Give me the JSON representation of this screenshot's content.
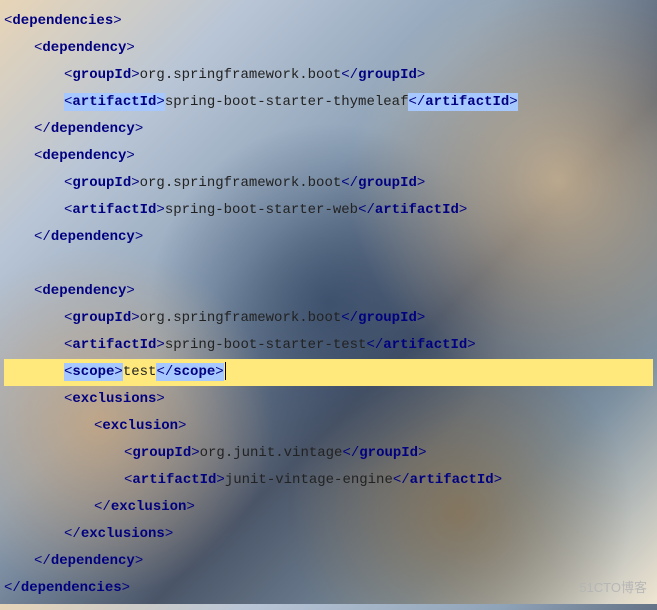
{
  "tags": {
    "dependencies_open": "dependencies",
    "dependencies_close": "dependencies",
    "dependency_open": "dependency",
    "dependency_close": "dependency",
    "groupId_open": "groupId",
    "groupId_close": "groupId",
    "artifactId_open": "artifactId",
    "artifactId_close": "artifactId",
    "scope_open": "scope",
    "scope_close": "scope",
    "exclusions_open": "exclusions",
    "exclusions_close": "exclusions",
    "exclusion_open": "exclusion",
    "exclusion_close": "exclusion"
  },
  "dep1": {
    "groupId": "org.springframework.boot",
    "artifactId": "spring-boot-starter-thymeleaf"
  },
  "dep2": {
    "groupId": "org.springframework.boot",
    "artifactId": "spring-boot-starter-web"
  },
  "dep3": {
    "groupId": "org.springframework.boot",
    "artifactId": "spring-boot-starter-test",
    "scope": "test",
    "exclusion": {
      "groupId": "org.junit.vintage",
      "artifactId": "junit-vintage-engine"
    }
  },
  "watermark": "51CTO博客"
}
